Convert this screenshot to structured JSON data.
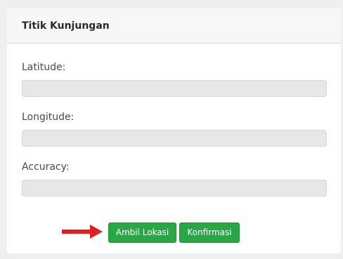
{
  "card": {
    "title": "Titik Kunjungan"
  },
  "fields": {
    "latitude": {
      "label": "Latitude:",
      "value": ""
    },
    "longitude": {
      "label": "Longitude:",
      "value": ""
    },
    "accuracy": {
      "label": "Accuracy:",
      "value": ""
    }
  },
  "actions": {
    "ambil_lokasi_label": "Ambil Lokasi",
    "konfirmasi_label": "Konfirmasi"
  },
  "annotation": {
    "arrow_color": "#e41e1e",
    "arrow_icon": "arrow-right-icon"
  },
  "colors": {
    "button_green": "#28a745",
    "input_bg": "#e6e7e8",
    "header_bg": "#f7f7f7"
  }
}
